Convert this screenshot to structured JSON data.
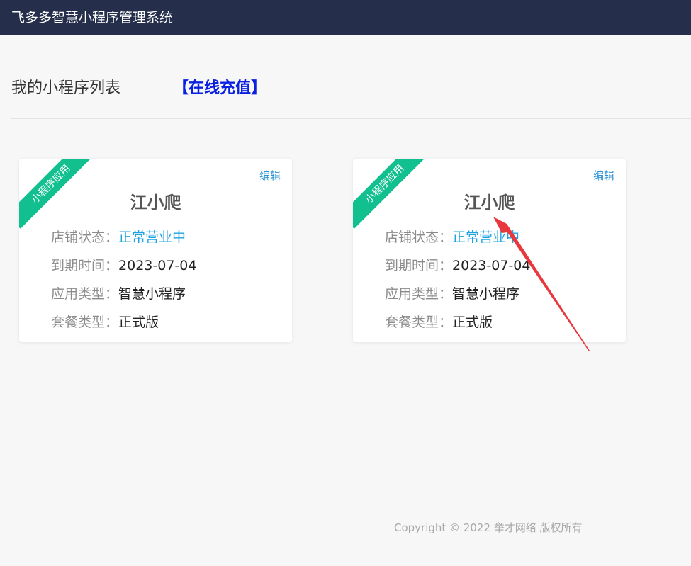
{
  "app": {
    "title": "飞多多智慧小程序管理系统"
  },
  "header": {
    "title": "我的小程序列表",
    "recharge_label": "【在线充值】"
  },
  "labels": {
    "status": "店铺状态：",
    "expire": "到期时间：",
    "app_type": "应用类型：",
    "plan": "套餐类型："
  },
  "cards": [
    {
      "ribbon": "小程序应用",
      "edit_label": "编辑",
      "name": "江小爬",
      "status": "正常营业中",
      "expire": "2023-07-04",
      "app_type": "智慧小程序",
      "plan": "正式版"
    },
    {
      "ribbon": "小程序应用",
      "edit_label": "编辑",
      "name": "江小爬",
      "status": "正常营业中",
      "expire": "2023-07-04",
      "app_type": "智慧小程序",
      "plan": "正式版"
    }
  ],
  "footer": {
    "copyright": "Copyright © 2022 举才网络 版权所有"
  },
  "colors": {
    "topbar": "#252f4b",
    "ribbon": "#12c08f",
    "link": "#2a93d5",
    "recharge": "#0a1fe0",
    "annotation_arrow": "#e8383d"
  }
}
